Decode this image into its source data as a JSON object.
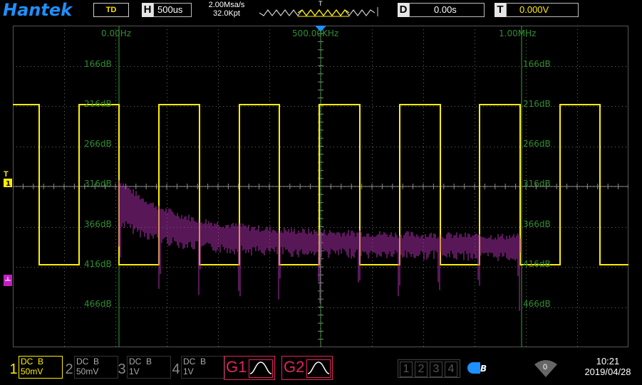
{
  "header": {
    "brand": "Hantek",
    "mode": "TD",
    "horizontal": {
      "letter": "H",
      "value": "500us"
    },
    "sample_rate": "2.00Msa/s",
    "memory_depth": "32.0Kpt",
    "trigger_marker": "T",
    "delay": {
      "letter": "D",
      "value": "0.00s"
    },
    "trigger_level": {
      "letter": "T",
      "value": "0.000V"
    }
  },
  "screen": {
    "freq_labels": [
      "0.00Hz",
      "500.00KHz",
      "1.00MHz"
    ],
    "db_labels": [
      "166dB",
      "216dB",
      "266dB",
      "316dB",
      "366dB",
      "416dB",
      "466dB"
    ],
    "trigger_marker": "T",
    "colors": {
      "grid": "#2a8a2a",
      "ch1": "#ffee00",
      "fft": "#b030b0",
      "cursor": "#1e90ff"
    }
  },
  "channels": [
    {
      "num": "1",
      "coupling": "DC  B",
      "vdiv": "50mV",
      "color": "#ffee00",
      "active": true
    },
    {
      "num": "2",
      "coupling": "DC  B",
      "vdiv": "50mV",
      "color": "#888888",
      "active": false
    },
    {
      "num": "3",
      "coupling": "DC  B",
      "vdiv": "1V",
      "color": "#888888",
      "active": false
    },
    {
      "num": "4",
      "coupling": "DC  B",
      "vdiv": "1V",
      "color": "#888888",
      "active": false
    }
  ],
  "math": [
    {
      "label": "G1"
    },
    {
      "label": "G2"
    }
  ],
  "bus_slots": [
    "1",
    "2",
    "3",
    "4"
  ],
  "usb_icon": "usb-icon",
  "wifi": {
    "icon": "wifi-icon",
    "count": "0"
  },
  "clock": {
    "time": "10:21",
    "date": "2019/04/28"
  }
}
